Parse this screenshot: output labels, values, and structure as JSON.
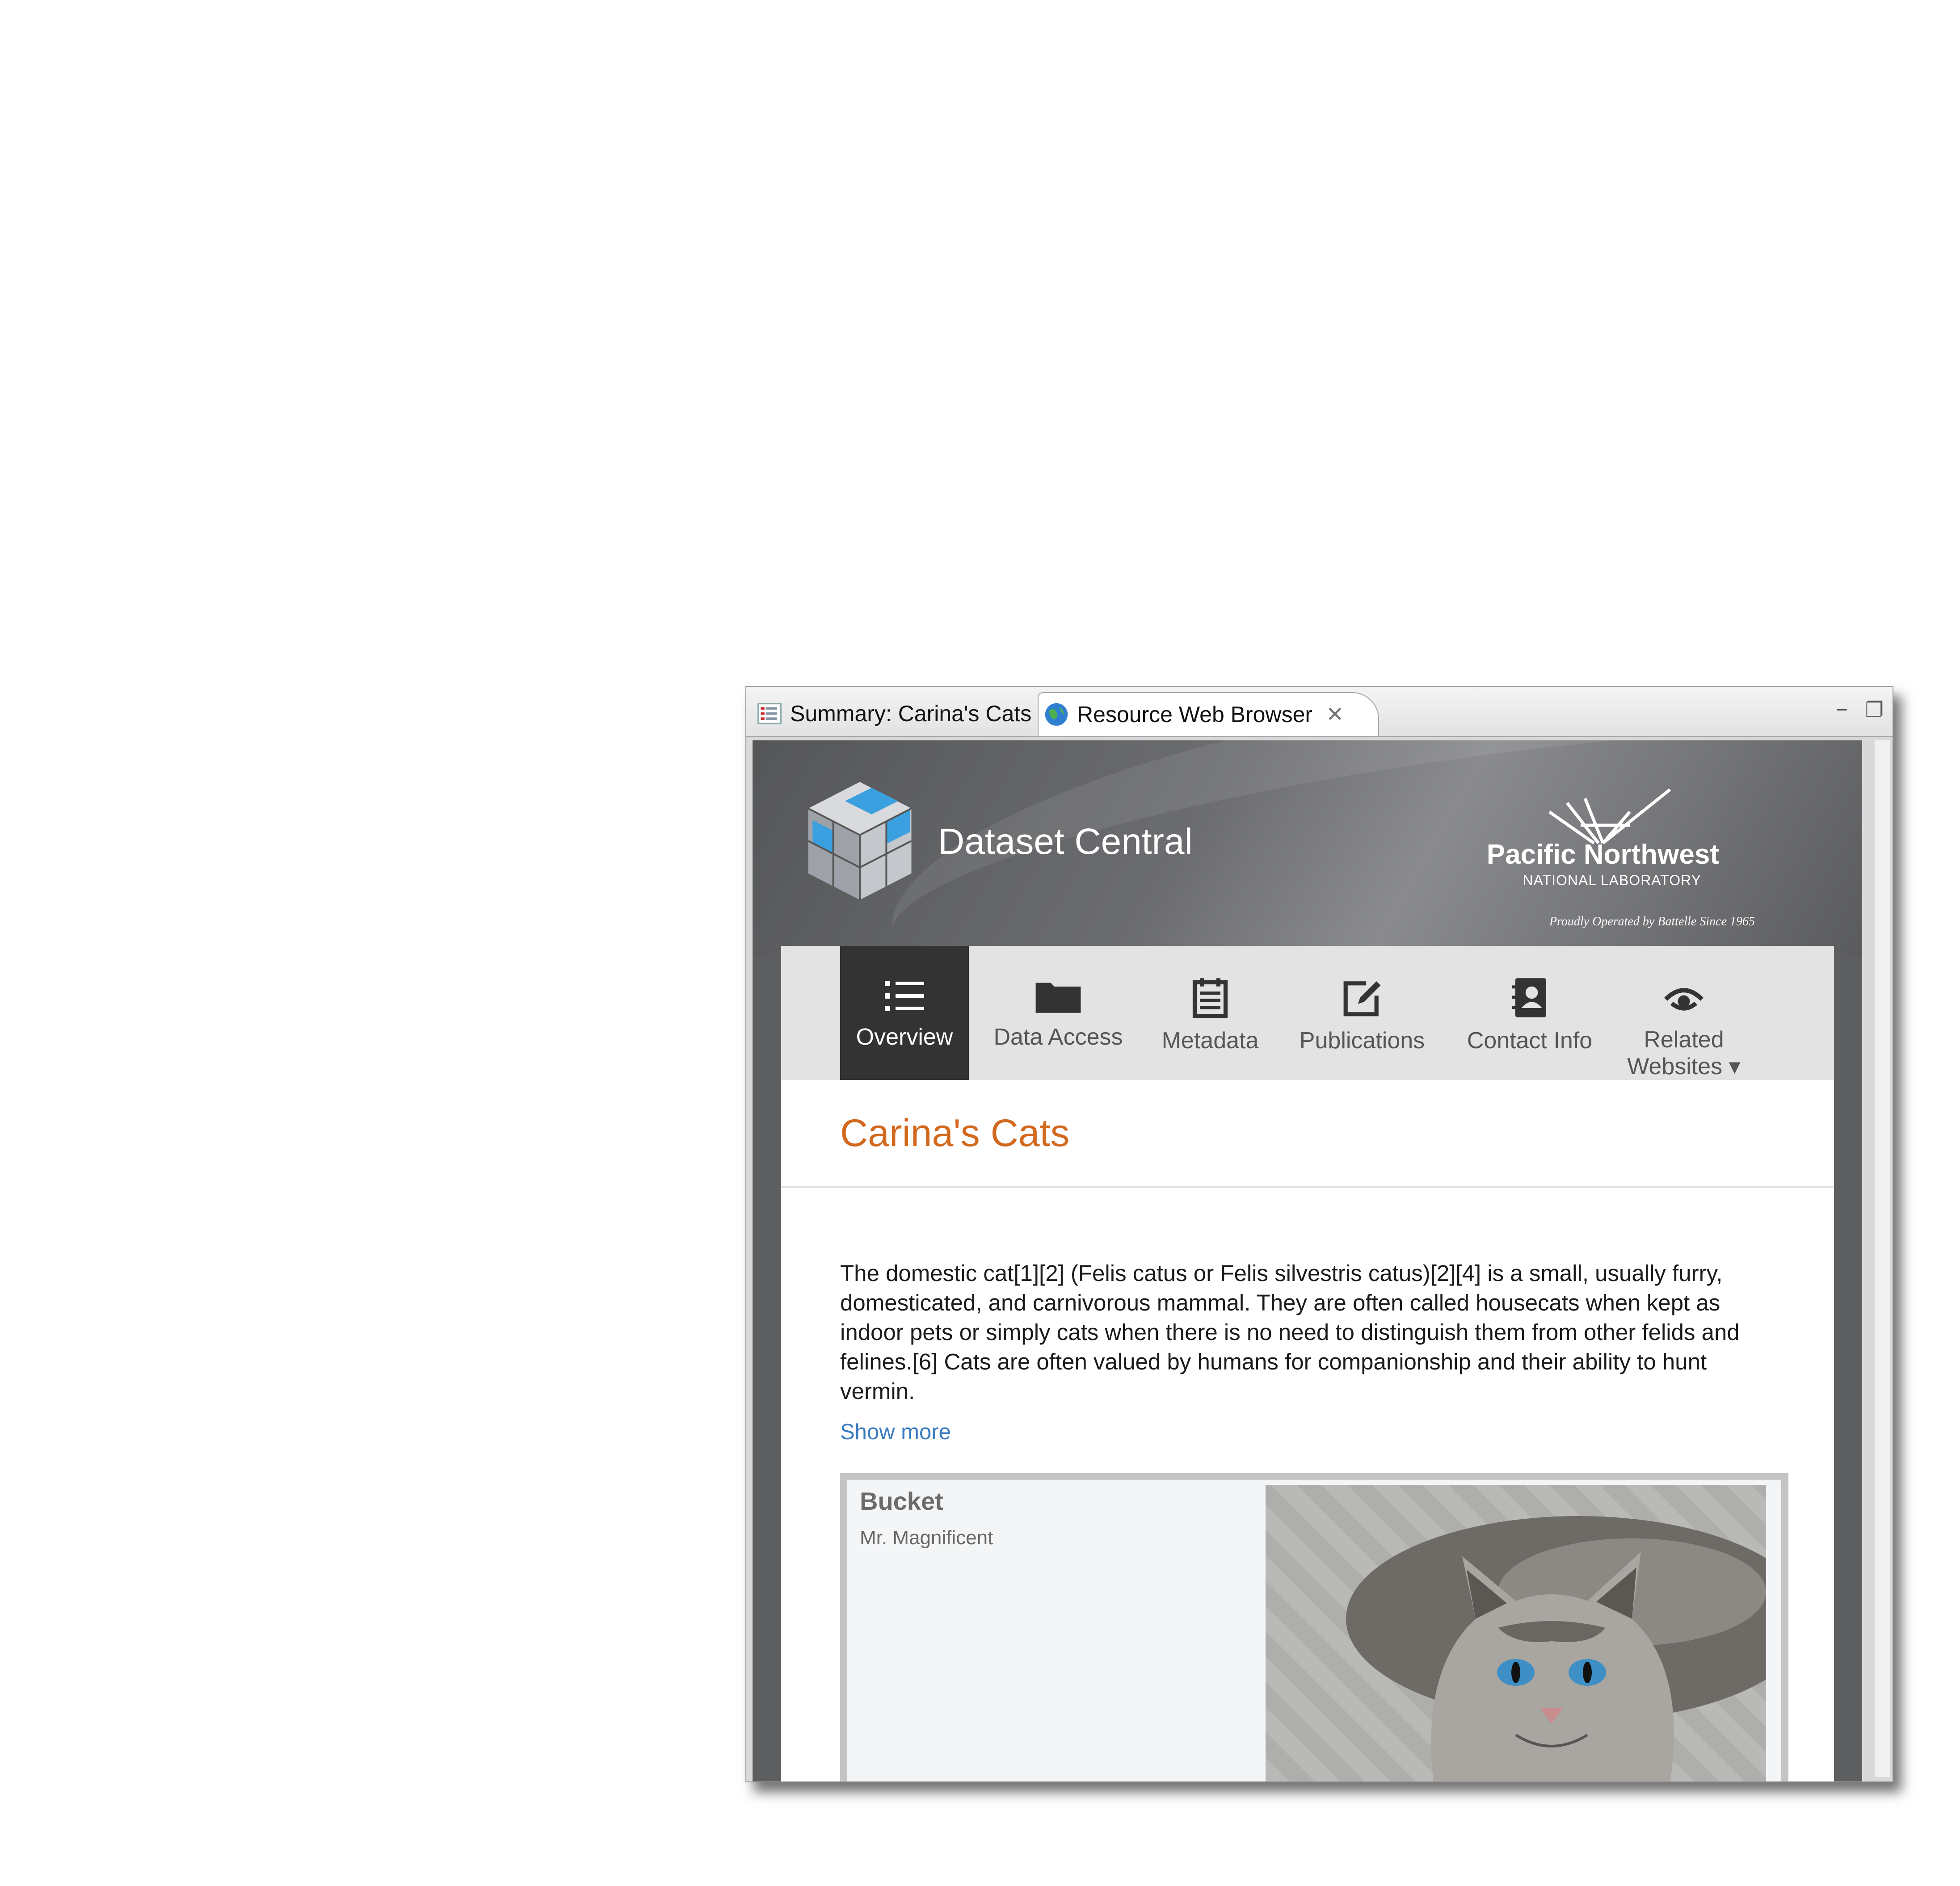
{
  "tabs": {
    "summary": "Summary: Carina's Cats",
    "browser": "Resource Web Browser"
  },
  "window_controls": {
    "minimize": "−",
    "maximize": "❐",
    "close_tab": "✕"
  },
  "header": {
    "brand": "Dataset Central",
    "org_name": "Pacific Northwest",
    "org_sub": "NATIONAL LABORATORY",
    "org_tag": "Proudly Operated by Battelle Since 1965"
  },
  "nav": {
    "overview": "Overview",
    "data_access": "Data Access",
    "metadata": "Metadata",
    "publications": "Publications",
    "contact_info": "Contact Info",
    "related_1": "Related",
    "related_2": "Websites ▾"
  },
  "page": {
    "title": "Carina's Cats",
    "description": "The domestic cat[1][2] (Felis catus or Felis silvestris catus)[2][4] is a small, usually furry, domesticated, and carnivorous mammal. They are often called housecats when kept as indoor pets or simply cats when there is no need to distinguish them from other felids and felines.[6] Cats are often valued by humans for companionship and their ability to hunt vermin.",
    "show_more": "Show more"
  },
  "card": {
    "title": "Bucket",
    "subtitle": "Mr. Magnificent"
  },
  "colors": {
    "title_accent": "#d2691e",
    "link": "#3a7bbf",
    "nav_active_bg": "#333333",
    "banner_bg": "#5d5e60"
  }
}
